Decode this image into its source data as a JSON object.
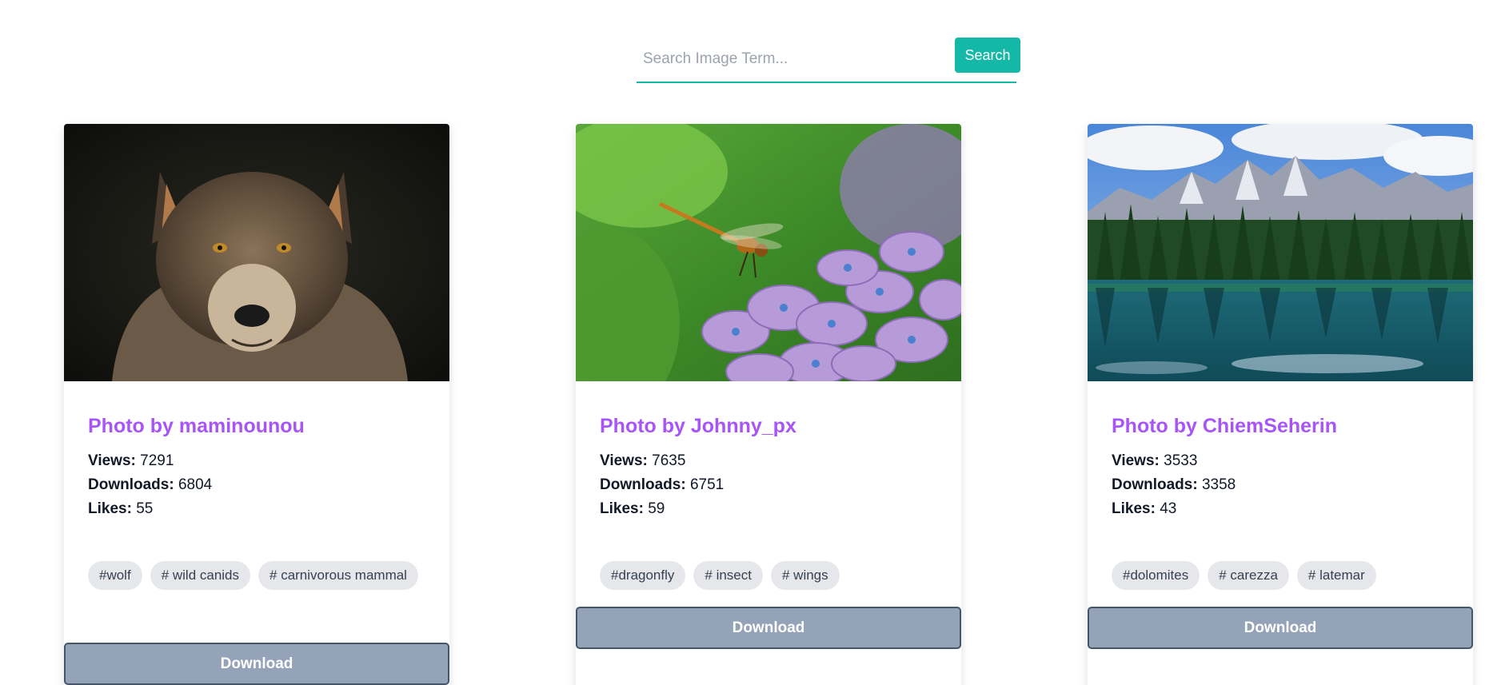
{
  "search": {
    "placeholder": "Search Image Term...",
    "value": "",
    "button_label": "Search"
  },
  "cards": [
    {
      "image_icon": "wolf-photo",
      "title": "Photo by maminounou",
      "views_label": "Views:",
      "views": "7291",
      "downloads_label": "Downloads:",
      "downloads": "6804",
      "likes_label": "Likes:",
      "likes": "55",
      "tags": [
        "#wolf",
        "# wild canids",
        "# carnivorous mammal"
      ],
      "download_label": "Download"
    },
    {
      "image_icon": "dragonfly-photo",
      "title": "Photo by Johnny_px",
      "views_label": "Views:",
      "views": "7635",
      "downloads_label": "Downloads:",
      "downloads": "6751",
      "likes_label": "Likes:",
      "likes": "59",
      "tags": [
        "#dragonfly",
        "# insect",
        "# wings"
      ],
      "download_label": "Download"
    },
    {
      "image_icon": "mountain-lake-photo",
      "title": "Photo by ChiemSeherin",
      "views_label": "Views:",
      "views": "3533",
      "downloads_label": "Downloads:",
      "downloads": "3358",
      "likes_label": "Likes:",
      "likes": "43",
      "tags": [
        "#dolomites",
        "# carezza",
        "# latemar"
      ],
      "download_label": "Download"
    }
  ],
  "colors": {
    "accent": "#14b8a6",
    "title": "#a855f7",
    "tag_bg": "#e5e7eb",
    "download_bg": "#94a3b8"
  }
}
